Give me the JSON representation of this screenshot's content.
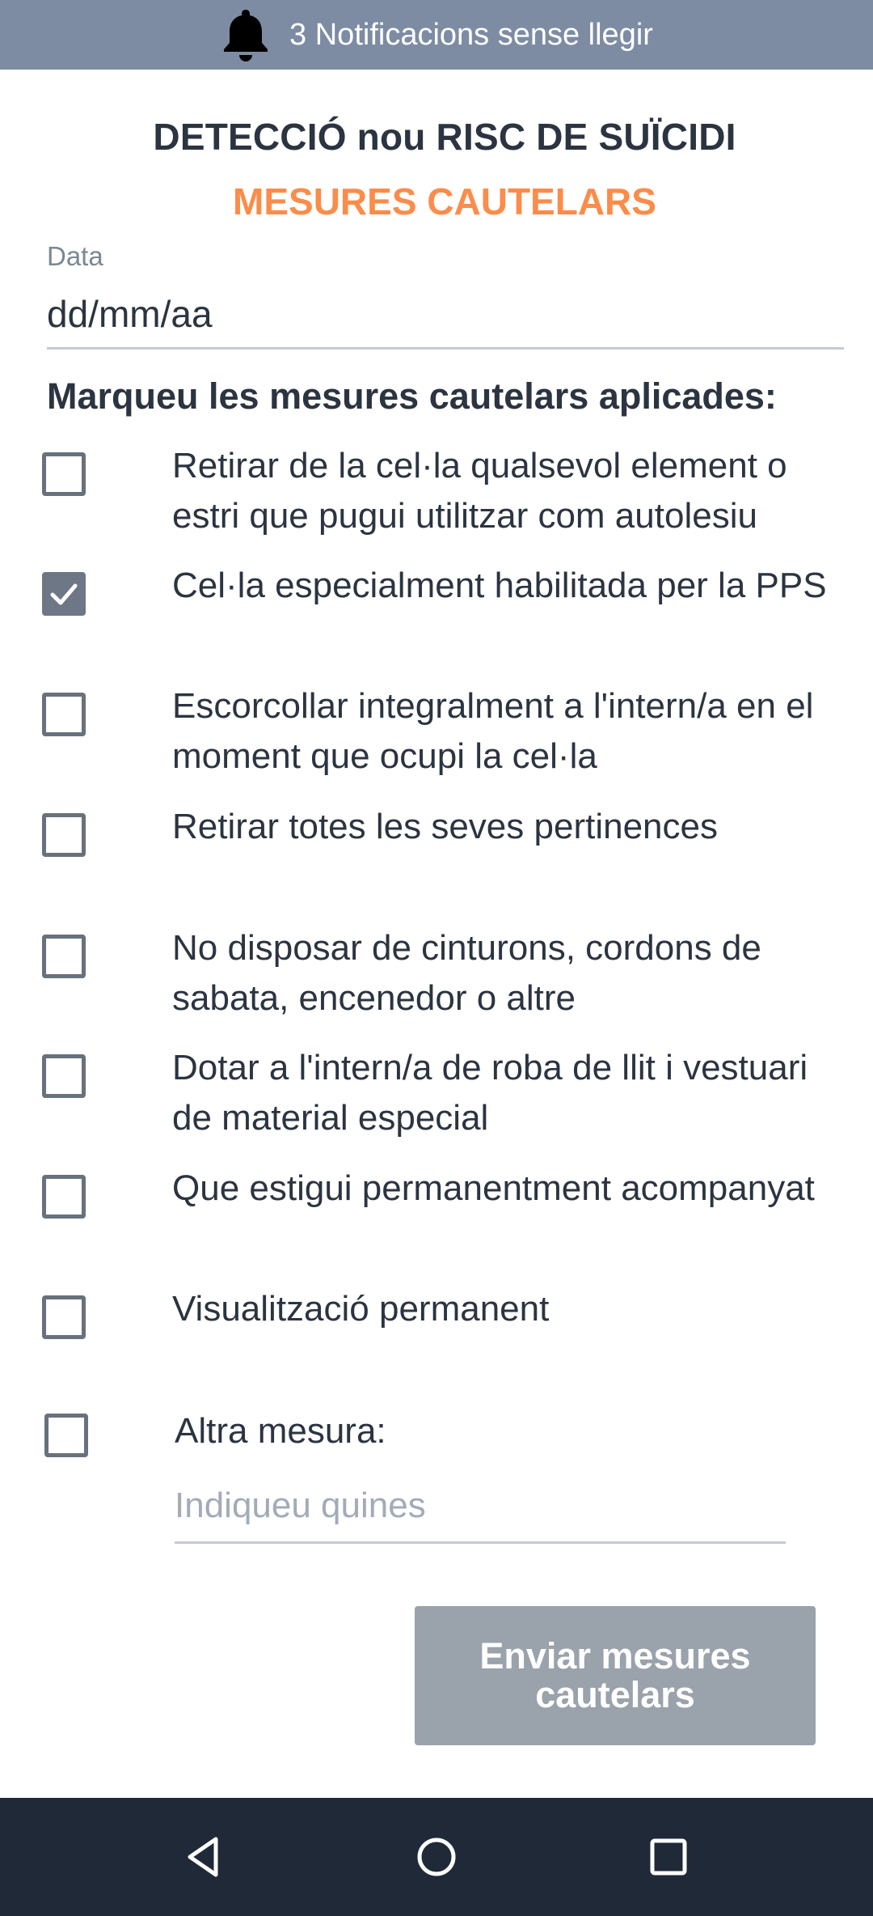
{
  "notifications": {
    "icon": "bell-icon",
    "text": "3 Notificacions sense llegir"
  },
  "header": {
    "title": "DETECCIÓ nou RISC DE SUÏCIDI",
    "subtitle": "MESURES CAUTELARS",
    "subtitle_color": "#fb8c4a"
  },
  "date_field": {
    "label": "Data",
    "placeholder": "dd/mm/aa"
  },
  "measures_heading": "Marqueu les mesures cautelars aplicades:",
  "measures": [
    {
      "label": "Retirar de la cel·la qualsevol element o estri que pugui utilitzar com autolesiu",
      "checked": false
    },
    {
      "label": "Cel·la especialment habilitada per la PPS",
      "checked": true
    },
    {
      "label": "Escorcollar integralment a l'intern/a en el moment que ocupi la cel·la",
      "checked": false
    },
    {
      "label": "Retirar totes les seves pertinences",
      "checked": false
    },
    {
      "label": "No disposar de cinturons, cordons de sabata, encenedor o altre",
      "checked": false
    },
    {
      "label": "Dotar a l'intern/a de roba de llit i vestuari de material especial",
      "checked": false
    },
    {
      "label": "Que estigui permanentment acompanyat",
      "checked": false
    },
    {
      "label": "Visualització permanent",
      "checked": false
    }
  ],
  "other_measure": {
    "label": "Altra mesura:",
    "placeholder": "Indiqueu quines",
    "checked": false
  },
  "submit": {
    "label": "Enviar mesures cautelars"
  },
  "nav_bar": {
    "back_icon": "back-triangle-icon",
    "home_icon": "home-circle-icon",
    "recents_icon": "recents-square-icon"
  }
}
